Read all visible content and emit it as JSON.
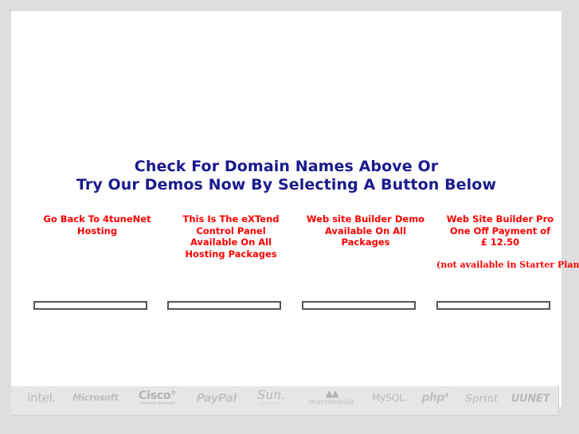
{
  "page": {
    "background_color": "#dedede",
    "content_background": "#ffffff",
    "accent_headline_color": "#1a1a8c",
    "accent_caption_color": "#ff0000"
  },
  "headline": {
    "line1": "Check For Domain Names Above Or",
    "line2": "Try Our Demos Now By Selecting A Button Below"
  },
  "demos": [
    {
      "id": "go-back-hosting",
      "caption_lines": [
        "Go Back To 4tuneNet",
        "Hosting"
      ],
      "note": ""
    },
    {
      "id": "extend-control-panel",
      "caption_lines": [
        "This Is The eXTend",
        "Control Panel",
        "Available On All",
        "Hosting Packages"
      ],
      "note": ""
    },
    {
      "id": "website-builder-demo",
      "caption_lines": [
        "Web site Builder Demo",
        "Available On All",
        "Packages"
      ],
      "note": ""
    },
    {
      "id": "website-builder-pro",
      "caption_lines": [
        "Web Site Builder Pro",
        "One Off Payment of",
        "£ 12.50"
      ],
      "note": "(not available in Starter Plan)"
    }
  ],
  "logos": [
    {
      "id": "intel-logo",
      "text": "intℯl."
    },
    {
      "id": "microsoft-logo",
      "text": "Microsoft"
    },
    {
      "id": "cisco-logo",
      "text": "Cisco°",
      "subtext": "Powered Network"
    },
    {
      "id": "paypal-logo",
      "text": "PayPal"
    },
    {
      "id": "sun-logo",
      "text": "Sun.",
      "subtext": "microsystems"
    },
    {
      "id": "macromedia-logo",
      "text": "macromedia",
      "mark": "▲▲"
    },
    {
      "id": "mysql-logo",
      "text": "MySQL."
    },
    {
      "id": "php-logo",
      "text": "php⁴"
    },
    {
      "id": "sprint-logo",
      "text": "Sprint"
    },
    {
      "id": "uunet-logo",
      "text": "UUNET"
    }
  ],
  "buttons": [
    {
      "id": "demo-button-1",
      "label": ""
    },
    {
      "id": "demo-button-2",
      "label": ""
    },
    {
      "id": "demo-button-3",
      "label": ""
    },
    {
      "id": "demo-button-4",
      "label": ""
    }
  ]
}
